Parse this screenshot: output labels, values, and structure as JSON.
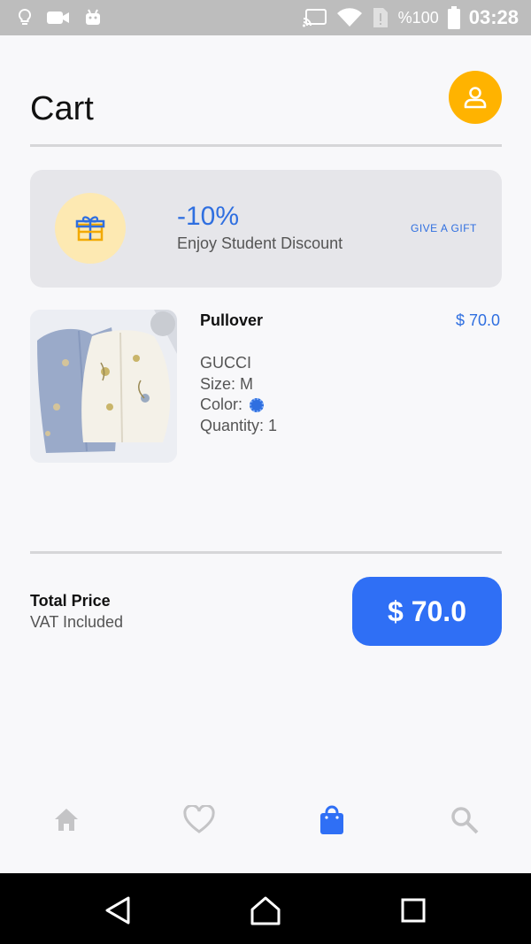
{
  "status_bar": {
    "battery_text": "%100",
    "time": "03:28",
    "icons": [
      "bulb-icon",
      "video-camera-icon",
      "android-icon",
      "cast-icon",
      "wifi-icon",
      "sim-alert-icon",
      "battery-icon"
    ]
  },
  "header": {
    "title": "Cart",
    "profile_icon": "person-icon"
  },
  "promo": {
    "discount": "-10%",
    "text": "Enjoy Student Discount",
    "link": "GIVE A GIFT",
    "icon": "gift-icon"
  },
  "cart_item": {
    "name": "Pullover",
    "price": "$ 70.0",
    "brand": "GUCCI",
    "size": "Size: M",
    "color_label": "Color:",
    "color_value": "#2f6fe0",
    "quantity": "Quantity: 1"
  },
  "total": {
    "label": "Total Price",
    "sub": "VAT Included",
    "amount": "$ 70.0"
  },
  "bottom_nav": {
    "items": [
      {
        "icon": "home-icon",
        "active": false
      },
      {
        "icon": "heart-icon",
        "active": false
      },
      {
        "icon": "shopping-bag-icon",
        "active": true
      },
      {
        "icon": "search-icon",
        "active": false
      }
    ]
  },
  "android_nav": {
    "icons": [
      "back-icon",
      "home-button-icon",
      "recents-icon"
    ]
  },
  "colors": {
    "accent": "#2f6ff5",
    "profile": "#ffb300",
    "promo_bg": "#e6e6ea"
  }
}
